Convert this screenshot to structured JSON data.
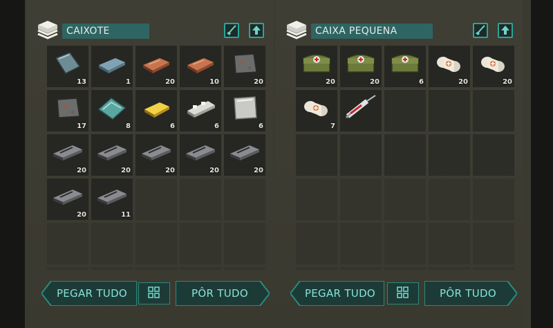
{
  "colors": {
    "panel_bg": "#3c3b31",
    "slot_bg": "#262722",
    "accent_teal": "#2e6563",
    "button_text": "#86e3d6"
  },
  "left": {
    "title": "CAIXOTE",
    "take_all_label": "PEGAR TUDO",
    "put_all_label": "PÔR TUDO",
    "items": [
      {
        "icon": "glass-sheet-icon",
        "count": "13"
      },
      {
        "icon": "steel-ingot-icon",
        "count": "1"
      },
      {
        "icon": "copper-ingot-icon",
        "count": "20"
      },
      {
        "icon": "copper-ingot-icon",
        "count": "10"
      },
      {
        "icon": "iron-plate-icon",
        "count": "20"
      },
      {
        "icon": "iron-plate-icon",
        "count": "17"
      },
      {
        "icon": "reinforced-glass-icon",
        "count": "8"
      },
      {
        "icon": "gold-ingot-icon",
        "count": "6"
      },
      {
        "icon": "silver-bar-icon",
        "count": "6"
      },
      {
        "icon": "steel-sheet-icon",
        "count": "6"
      },
      {
        "icon": "metal-bar-icon",
        "count": "20"
      },
      {
        "icon": "metal-bar-icon",
        "count": "20"
      },
      {
        "icon": "metal-bar-icon",
        "count": "20"
      },
      {
        "icon": "metal-bar-icon",
        "count": "20"
      },
      {
        "icon": "metal-bar-icon",
        "count": "20"
      },
      {
        "icon": "metal-bar-icon",
        "count": "20"
      },
      {
        "icon": "metal-bar-icon",
        "count": "11"
      }
    ]
  },
  "right": {
    "title": "CAIXA PEQUENA",
    "take_all_label": "PEGAR TUDO",
    "put_all_label": "PÔR TUDO",
    "items": [
      {
        "icon": "medkit-bag-icon",
        "count": "20"
      },
      {
        "icon": "medkit-bag-icon",
        "count": "20"
      },
      {
        "icon": "medkit-bag-icon",
        "count": "6"
      },
      {
        "icon": "bandage-icon",
        "count": "20"
      },
      {
        "icon": "bandage-icon",
        "count": "20"
      },
      {
        "icon": "bandage-icon",
        "count": "7"
      },
      {
        "icon": "syringe-icon",
        "count": ""
      }
    ]
  }
}
